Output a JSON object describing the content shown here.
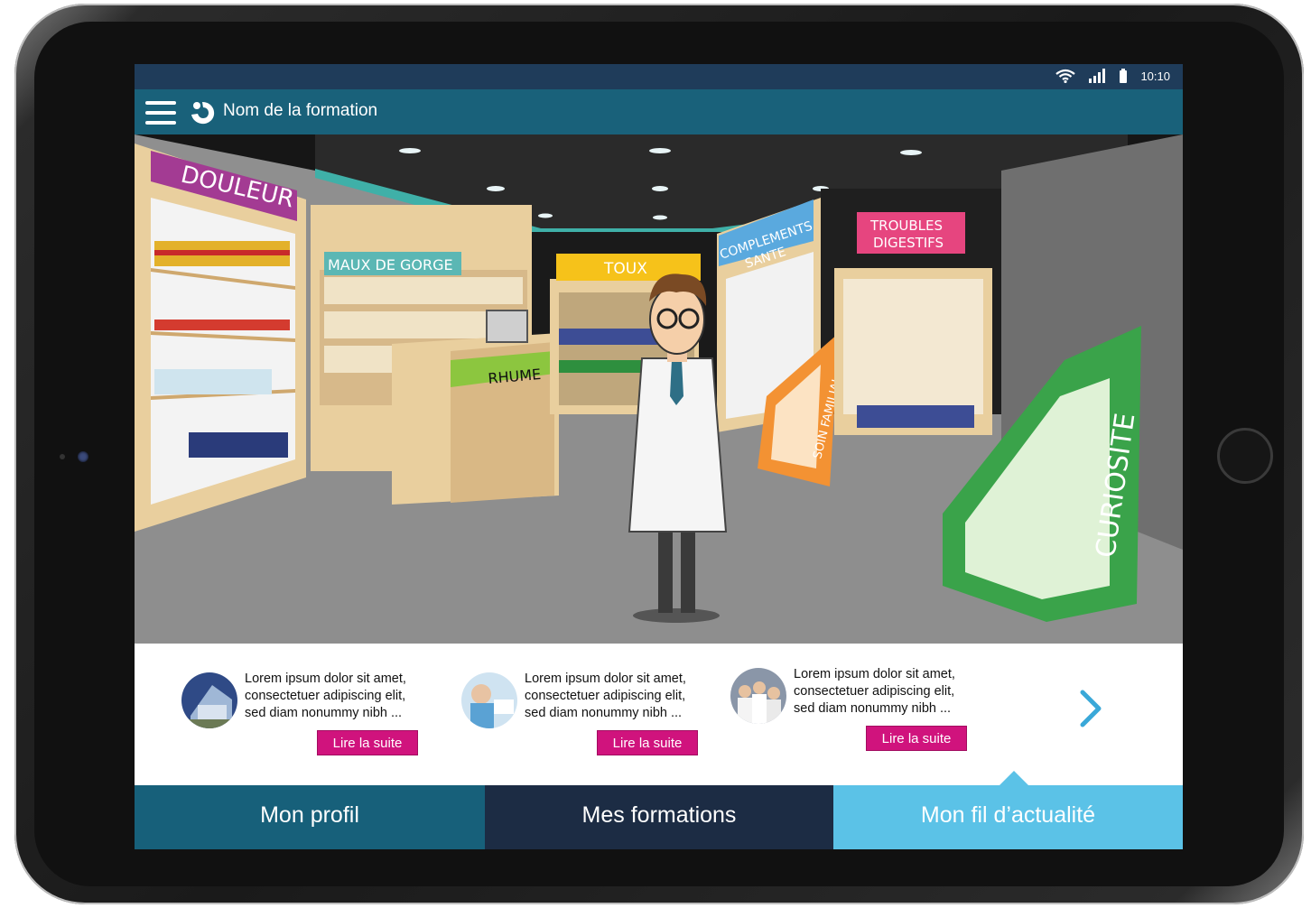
{
  "status": {
    "time": "10:10",
    "icons": [
      "wifi-icon",
      "signal-icon",
      "battery-icon"
    ]
  },
  "appbar": {
    "title": "Nom de la formation",
    "icons": [
      "menu-icon",
      "logo-icon"
    ]
  },
  "scene": {
    "signs": {
      "douleur": "DOULEUR",
      "maux_de_gorge": "MAUX DE GORGE",
      "toux": "TOUX",
      "rhume": "RHUME",
      "complements_line1": "COMPLEMENTS",
      "complements_line2": "SANTE",
      "troubles_line1": "TROUBLES",
      "troubles_line2": "DIGESTIFS",
      "soin_familial": "SOIN FAMILIAL",
      "curiosite": "CURIOSITE"
    }
  },
  "news": {
    "items": [
      {
        "line1": "Lorem ipsum dolor sit amet,",
        "line2": "consectetuer adipiscing elit,",
        "line3": "sed diam nonummy nibh ...",
        "button": "Lire la suite"
      },
      {
        "line1": "Lorem ipsum dolor sit amet,",
        "line2": "consectetuer adipiscing elit,",
        "line3": "sed diam nonummy nibh ...",
        "button": "Lire la suite"
      },
      {
        "line1": "Lorem ipsum dolor sit amet,",
        "line2": "consectetuer adipiscing elit,",
        "line3": "sed diam nonummy nibh ...",
        "button": "Lire la suite"
      }
    ],
    "next_icon": "chevron-right-icon"
  },
  "tabs": [
    {
      "label": "Mon profil",
      "color": "#17607a"
    },
    {
      "label": "Mes formations",
      "color": "#1c2c44"
    },
    {
      "label": "Mon fil d’actualité",
      "color": "#5bc2e7",
      "active": true
    }
  ],
  "colors": {
    "statusbar": "#1f3c5a",
    "appbar": "#19617a",
    "accent": "#d0137d"
  }
}
